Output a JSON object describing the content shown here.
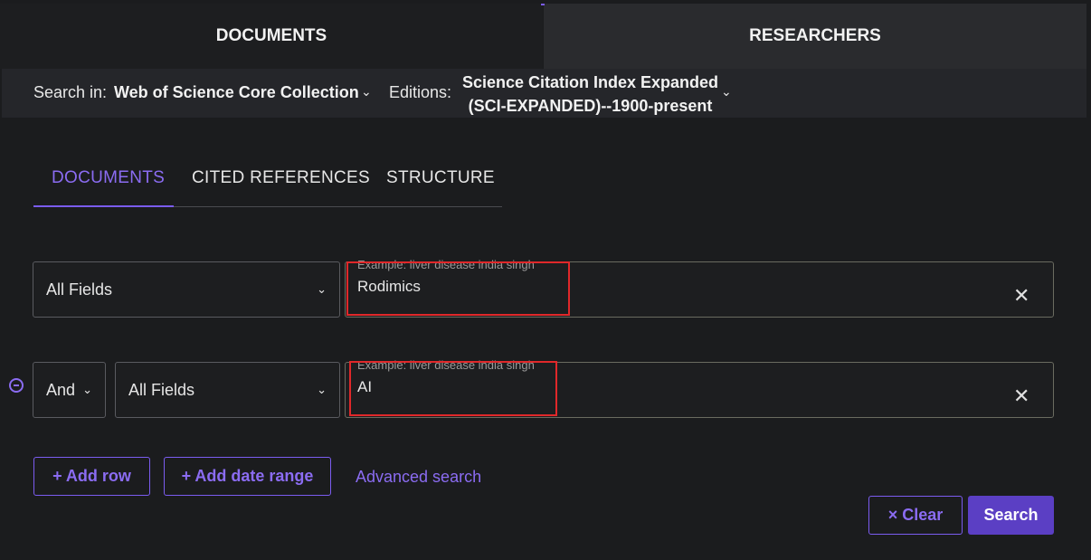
{
  "top_tabs": {
    "documents": "DOCUMENTS",
    "researchers": "RESEARCHERS"
  },
  "search_in": {
    "label": "Search in:",
    "value": "Web of Science Core Collection",
    "editions_label": "Editions:",
    "editions_line1": "Science Citation Index Expanded",
    "editions_line2": "(SCI-EXPANDED)--1900-present"
  },
  "inner_tabs": {
    "documents": "DOCUMENTS",
    "cited_references": "CITED REFERENCES",
    "structure": "STRUCTURE"
  },
  "rows": [
    {
      "field": "All Fields",
      "hint": "Example: liver disease india singh",
      "value": "Rodimics"
    },
    {
      "operator": "And",
      "field": "All Fields",
      "hint": "Example: liver disease india singh",
      "value": "AI"
    }
  ],
  "actions": {
    "add_row": "+ Add row",
    "add_date_range": "+ Add date range",
    "advanced_search": "Advanced search",
    "clear": "× Clear",
    "search": "Search"
  },
  "icons": {
    "chevron": "chevron-down-icon",
    "clear": "close-icon",
    "remove_row": "minus-circle-icon"
  },
  "colors": {
    "accent": "#7b5cf0",
    "search_button": "#5b3fc4",
    "highlight": "#e0282a"
  }
}
